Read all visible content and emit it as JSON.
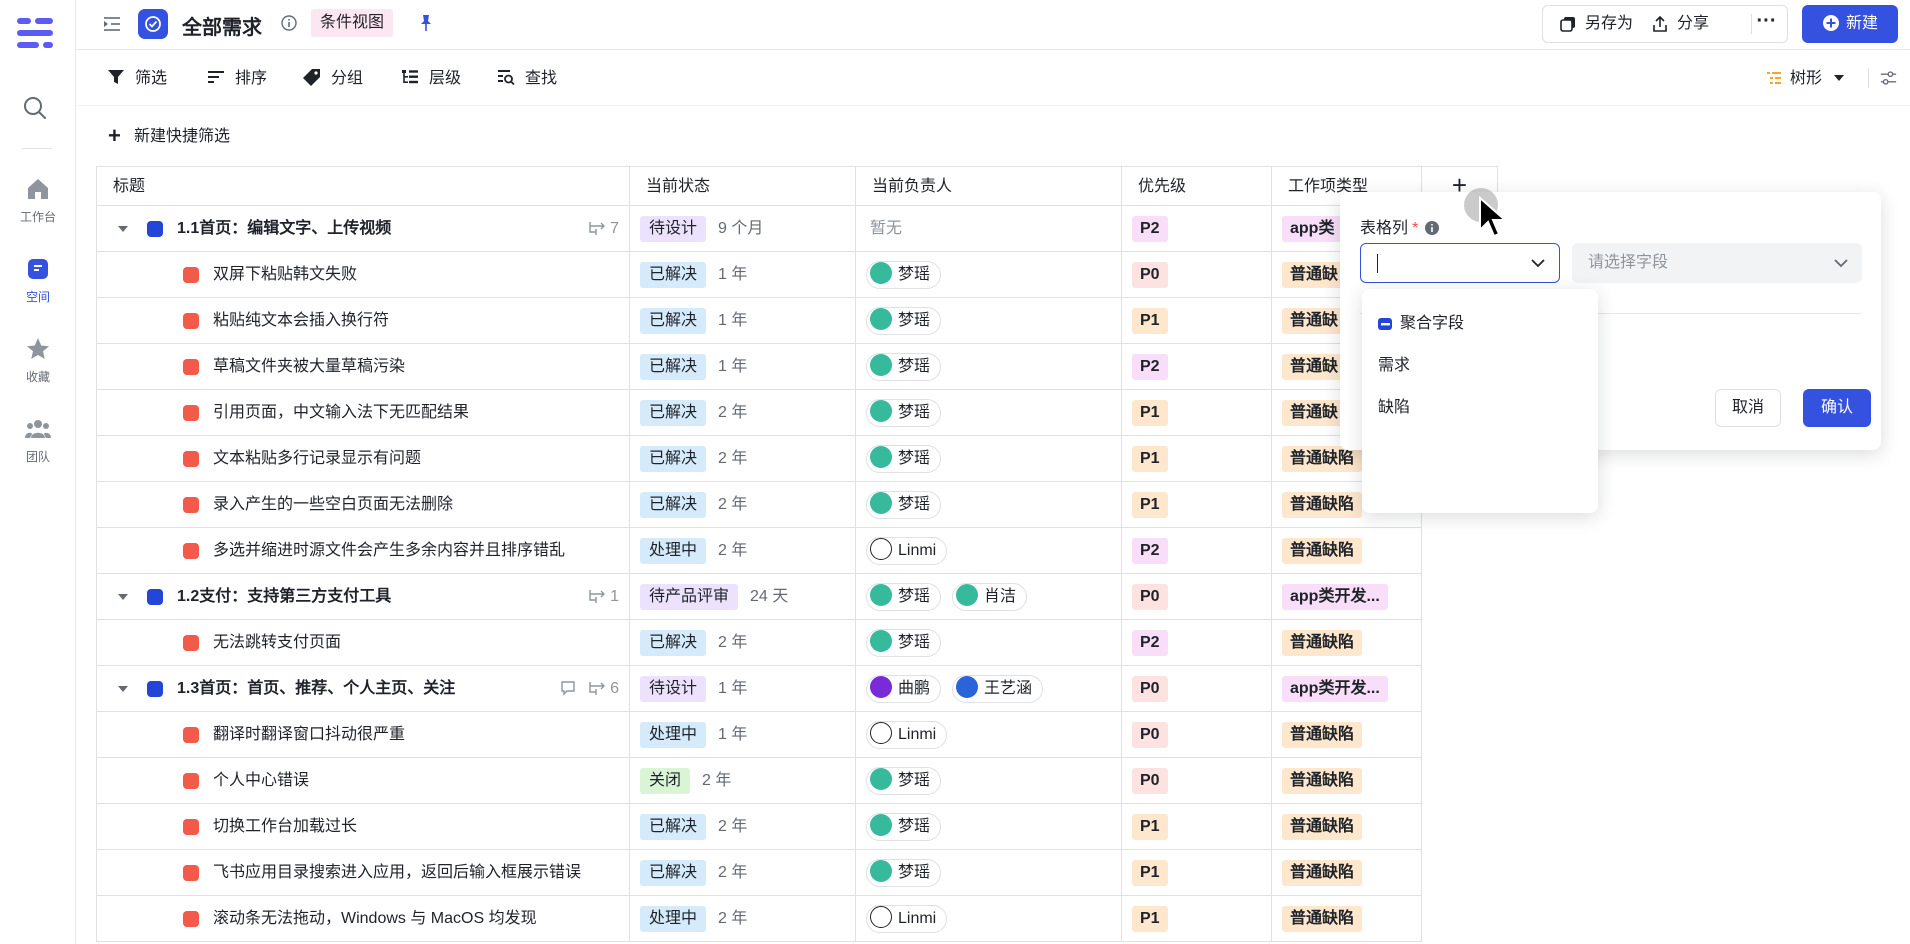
{
  "rail": {
    "items": [
      {
        "label": "工作台",
        "icon": "home-icon"
      },
      {
        "label": "空间",
        "icon": "space-icon",
        "active": true
      },
      {
        "label": "收藏",
        "icon": "star-icon"
      },
      {
        "label": "团队",
        "icon": "team-icon"
      }
    ]
  },
  "header": {
    "title": "全部需求",
    "view_badge": "条件视图",
    "save_as": "另存为",
    "share": "分享",
    "more": "···",
    "new": "新建"
  },
  "toolbar": {
    "filter": "筛选",
    "sort": "排序",
    "group": "分组",
    "level": "层级",
    "find": "查找",
    "view_mode": "树形"
  },
  "quick_filter": "新建快捷筛选",
  "table": {
    "columns": [
      "标题",
      "当前状态",
      "当前负责人",
      "优先级",
      "工作项类型"
    ],
    "add_column": "+",
    "rows": [
      {
        "kind": "parent",
        "title": "1.1首页：编辑文字、上传视频",
        "sub_count": "7",
        "comment": false,
        "status": "待设计",
        "ago": "9 个月",
        "owners": [],
        "none": "暂无",
        "priority": "P2",
        "type": "app类"
      },
      {
        "kind": "child",
        "title": "双屏下粘贴韩文失败",
        "status": "已解决",
        "ago": "1 年",
        "owners": [
          "梦瑶"
        ],
        "priority": "P0",
        "type": "普通缺"
      },
      {
        "kind": "child",
        "title": "粘贴纯文本会插入换行符",
        "status": "已解决",
        "ago": "1 年",
        "owners": [
          "梦瑶"
        ],
        "priority": "P1",
        "type": "普通缺"
      },
      {
        "kind": "child",
        "title": "草稿文件夹被大量草稿污染",
        "status": "已解决",
        "ago": "1 年",
        "owners": [
          "梦瑶"
        ],
        "priority": "P2",
        "type": "普通缺"
      },
      {
        "kind": "child",
        "title": "引用页面，中文输入法下无匹配结果",
        "status": "已解决",
        "ago": "2 年",
        "owners": [
          "梦瑶"
        ],
        "priority": "P1",
        "type": "普通缺"
      },
      {
        "kind": "child",
        "title": "文本粘贴多行记录显示有问题",
        "status": "已解决",
        "ago": "2 年",
        "owners": [
          "梦瑶"
        ],
        "priority": "P1",
        "type": "普通缺陷"
      },
      {
        "kind": "child",
        "title": "录入产生的一些空白页面无法删除",
        "status": "已解决",
        "ago": "2 年",
        "owners": [
          "梦瑶"
        ],
        "priority": "P1",
        "type": "普通缺陷"
      },
      {
        "kind": "child",
        "title": "多选并缩进时源文件会产生多余内容并且排序错乱",
        "status": "处理中",
        "ago": "2 年",
        "owners": [
          "Linmi"
        ],
        "priority": "P2",
        "type": "普通缺陷"
      },
      {
        "kind": "parent",
        "title": "1.2支付：支持第三方支付工具",
        "sub_count": "1",
        "comment": false,
        "status": "待产品评审",
        "ago": "24 天",
        "owners": [
          "梦瑶",
          "肖洁"
        ],
        "priority": "P0",
        "type": "app类开发..."
      },
      {
        "kind": "child",
        "title": "无法跳转支付页面",
        "status": "已解决",
        "ago": "2 年",
        "owners": [
          "梦瑶"
        ],
        "priority": "P2",
        "type": "普通缺陷"
      },
      {
        "kind": "parent",
        "title": "1.3首页：首页、推荐、个人主页、关注",
        "sub_count": "6",
        "comment": true,
        "status": "待设计",
        "ago": "1 年",
        "owners": [
          "曲鹏",
          "王艺涵"
        ],
        "priority": "P0",
        "type": "app类开发..."
      },
      {
        "kind": "child",
        "title": "翻译时翻译窗口抖动很严重",
        "status": "处理中",
        "ago": "1 年",
        "owners": [
          "Linmi"
        ],
        "priority": "P0",
        "type": "普通缺陷"
      },
      {
        "kind": "child",
        "title": "个人中心错误",
        "status": "关闭",
        "ago": "2 年",
        "owners": [
          "梦瑶"
        ],
        "priority": "P0",
        "type": "普通缺陷"
      },
      {
        "kind": "child",
        "title": "切换工作台加载过长",
        "status": "已解决",
        "ago": "2 年",
        "owners": [
          "梦瑶"
        ],
        "priority": "P1",
        "type": "普通缺陷"
      },
      {
        "kind": "child",
        "title": "飞书应用目录搜索进入应用，返回后输入框展示错误",
        "status": "已解决",
        "ago": "2 年",
        "owners": [
          "梦瑶"
        ],
        "priority": "P1",
        "type": "普通缺陷"
      },
      {
        "kind": "child",
        "title": "滚动条无法拖动，Windows 与 MacOS 均发现",
        "status": "处理中",
        "ago": "2 年",
        "owners": [
          "Linmi"
        ],
        "priority": "P1",
        "type": "普通缺陷"
      }
    ]
  },
  "popover": {
    "label": "表格列",
    "required": "*",
    "field_placeholder": "请选择字段",
    "cancel": "取消",
    "confirm": "确认",
    "options": [
      "聚合字段",
      "需求",
      "缺陷"
    ]
  },
  "colors": {
    "accent": "#3451e0",
    "status_blue": "#d5ebfb",
    "status_purple": "#ece2fe",
    "status_green": "#d9f5d6",
    "p0": "#fde2e2",
    "p1": "#fee7cd",
    "p2": "#f8def8",
    "bug_type": "#fee7cd",
    "app_type": "#f8def8"
  }
}
